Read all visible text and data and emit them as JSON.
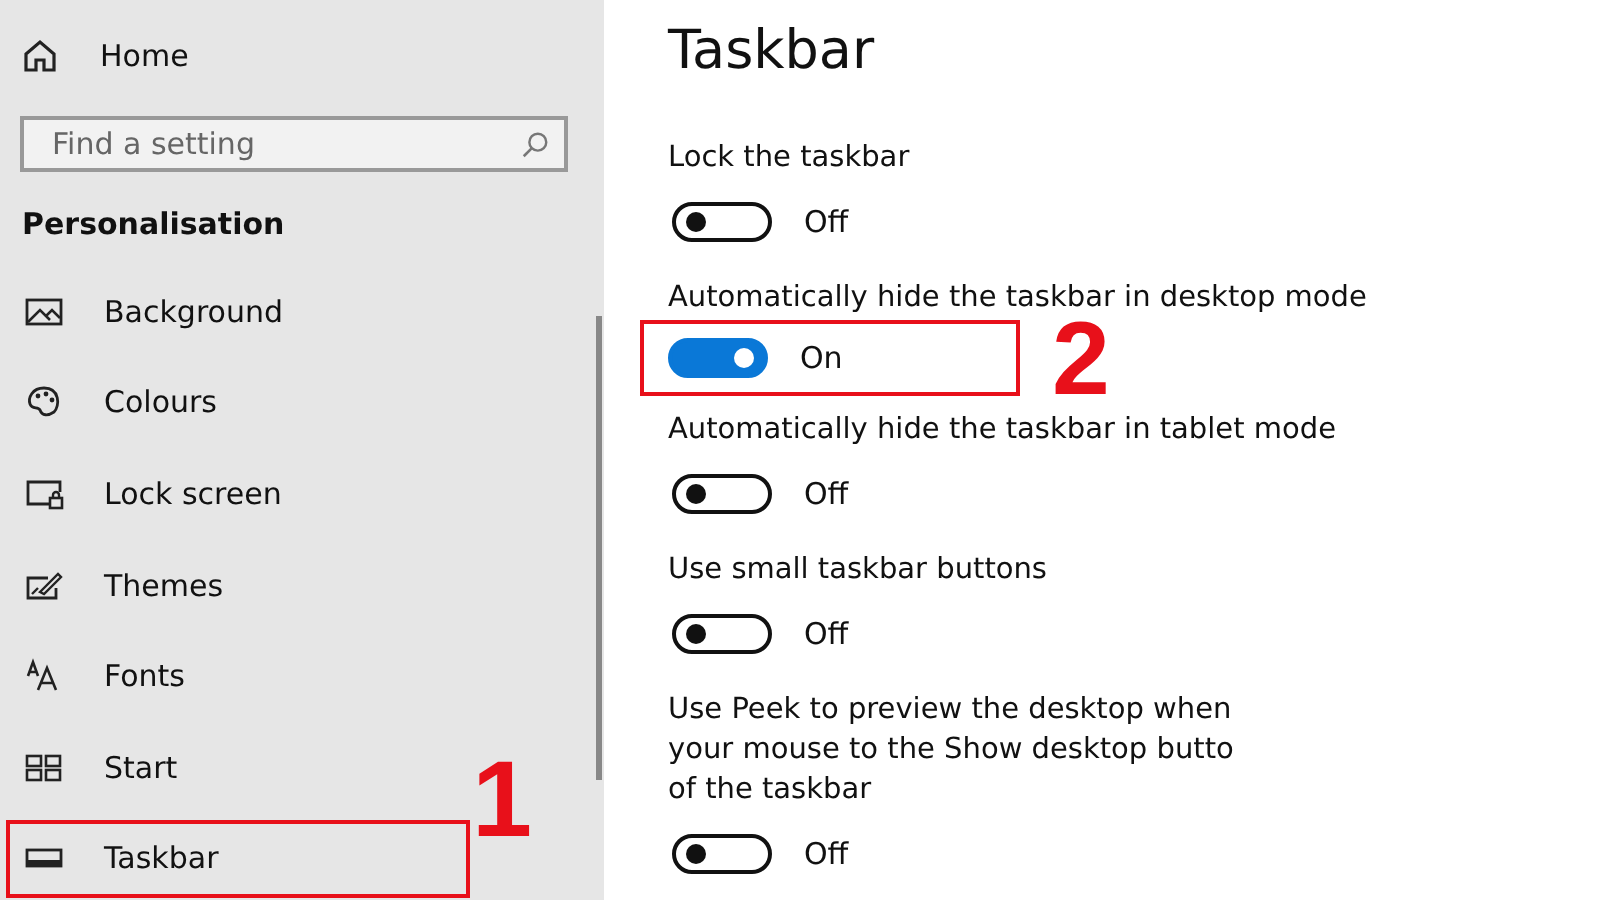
{
  "sidebar": {
    "home": "Home",
    "search": {
      "placeholder": "Find a setting"
    },
    "section": "Personalisation",
    "items": [
      {
        "label": "Background",
        "kind": "image"
      },
      {
        "label": "Colours",
        "kind": "palette"
      },
      {
        "label": "Lock screen",
        "kind": "lock"
      },
      {
        "label": "Themes",
        "kind": "themes"
      },
      {
        "label": "Fonts",
        "kind": "fonts"
      },
      {
        "label": "Start",
        "kind": "start"
      },
      {
        "label": "Taskbar",
        "kind": "taskbar",
        "annotation": "1"
      }
    ]
  },
  "main": {
    "title": "Taskbar",
    "settings": [
      {
        "label": [
          "Lock the taskbar"
        ],
        "on": false,
        "status": "Off"
      },
      {
        "label": [
          "Automatically hide the taskbar in desktop mode"
        ],
        "on": true,
        "status": "On",
        "annotation": "2"
      },
      {
        "label": [
          "Automatically hide the taskbar in tablet mode"
        ],
        "on": false,
        "status": "Off"
      },
      {
        "label": [
          "Use small taskbar buttons"
        ],
        "on": false,
        "status": "Off"
      },
      {
        "label": [
          "Use Peek to preview the desktop when",
          "your mouse to the Show desktop butto",
          "of the taskbar"
        ],
        "on": false,
        "status": "Off"
      }
    ]
  }
}
